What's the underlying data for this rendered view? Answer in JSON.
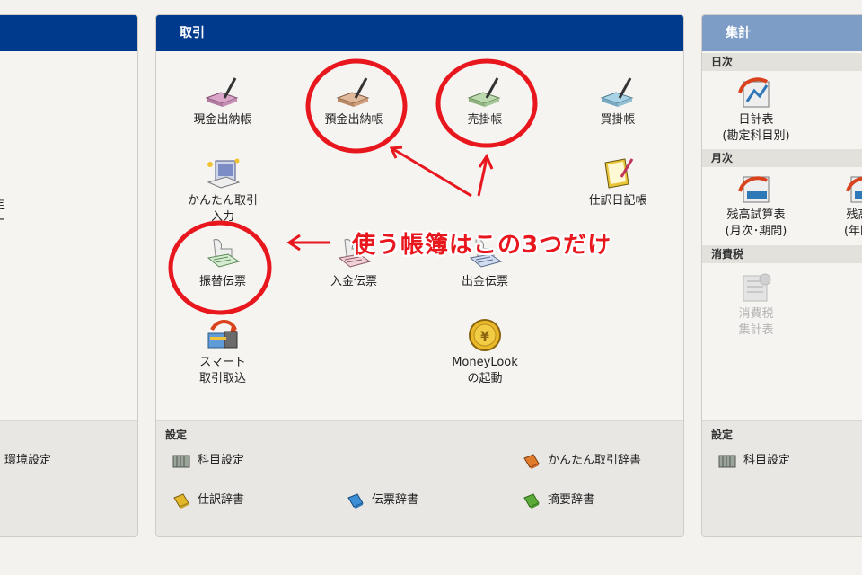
{
  "left_panel": {
    "fragment_1": "定",
    "fragment_2": "ー",
    "footer_item": "環境設定"
  },
  "torihiki": {
    "title": "取引",
    "items": [
      {
        "label": "現金出納帳",
        "icon": "cash-book-icon"
      },
      {
        "label": "預金出納帳",
        "icon": "deposit-book-icon"
      },
      {
        "label": "売掛帳",
        "icon": "receivable-book-icon"
      },
      {
        "label": "買掛帳",
        "icon": "payable-book-icon"
      },
      {
        "label": "かんたん取引\n入力",
        "icon": "easy-entry-icon"
      },
      {
        "label": "仕訳日記帳",
        "icon": "journal-icon"
      },
      {
        "label": "振替伝票",
        "icon": "transfer-slip-icon"
      },
      {
        "label": "入金伝票",
        "icon": "receipt-slip-icon"
      },
      {
        "label": "出金伝票",
        "icon": "payment-slip-icon"
      },
      {
        "label": "スマート\n取引取込",
        "icon": "smart-import-icon"
      },
      {
        "label": "MoneyLook\nの起動",
        "icon": "moneylook-coin-icon"
      }
    ],
    "footer": {
      "label": "設定",
      "items": [
        {
          "label": "科目設定",
          "color": "#9aa59a"
        },
        {
          "label": "かんたん取引辞書",
          "color": "#e07b2c"
        },
        {
          "label": "仕訳辞書",
          "color": "#e2b82a"
        },
        {
          "label": "伝票辞書",
          "color": "#3a8fd6"
        },
        {
          "label": "摘要辞書",
          "color": "#5cab3a"
        }
      ]
    }
  },
  "shukei": {
    "title": "集計",
    "sections": [
      {
        "label": "日次"
      },
      {
        "label": "月次"
      },
      {
        "label": "消費税"
      }
    ],
    "items": [
      {
        "label": "日計表\n(勘定科目別)"
      },
      {
        "label": "残高試算表\n(月次･期間)"
      },
      {
        "label": "残高試\n(年間推"
      },
      {
        "label": "消費税\n集計表"
      }
    ],
    "footer": {
      "label": "設定",
      "item": "科目設定"
    }
  },
  "annotation": {
    "text": "使う帳簿はこの3つだけ",
    "color": "#e8161d"
  },
  "colors": {
    "header_blue": "#003a8c",
    "header_light": "#7d9cc6",
    "annotation_red": "#e8161d"
  }
}
